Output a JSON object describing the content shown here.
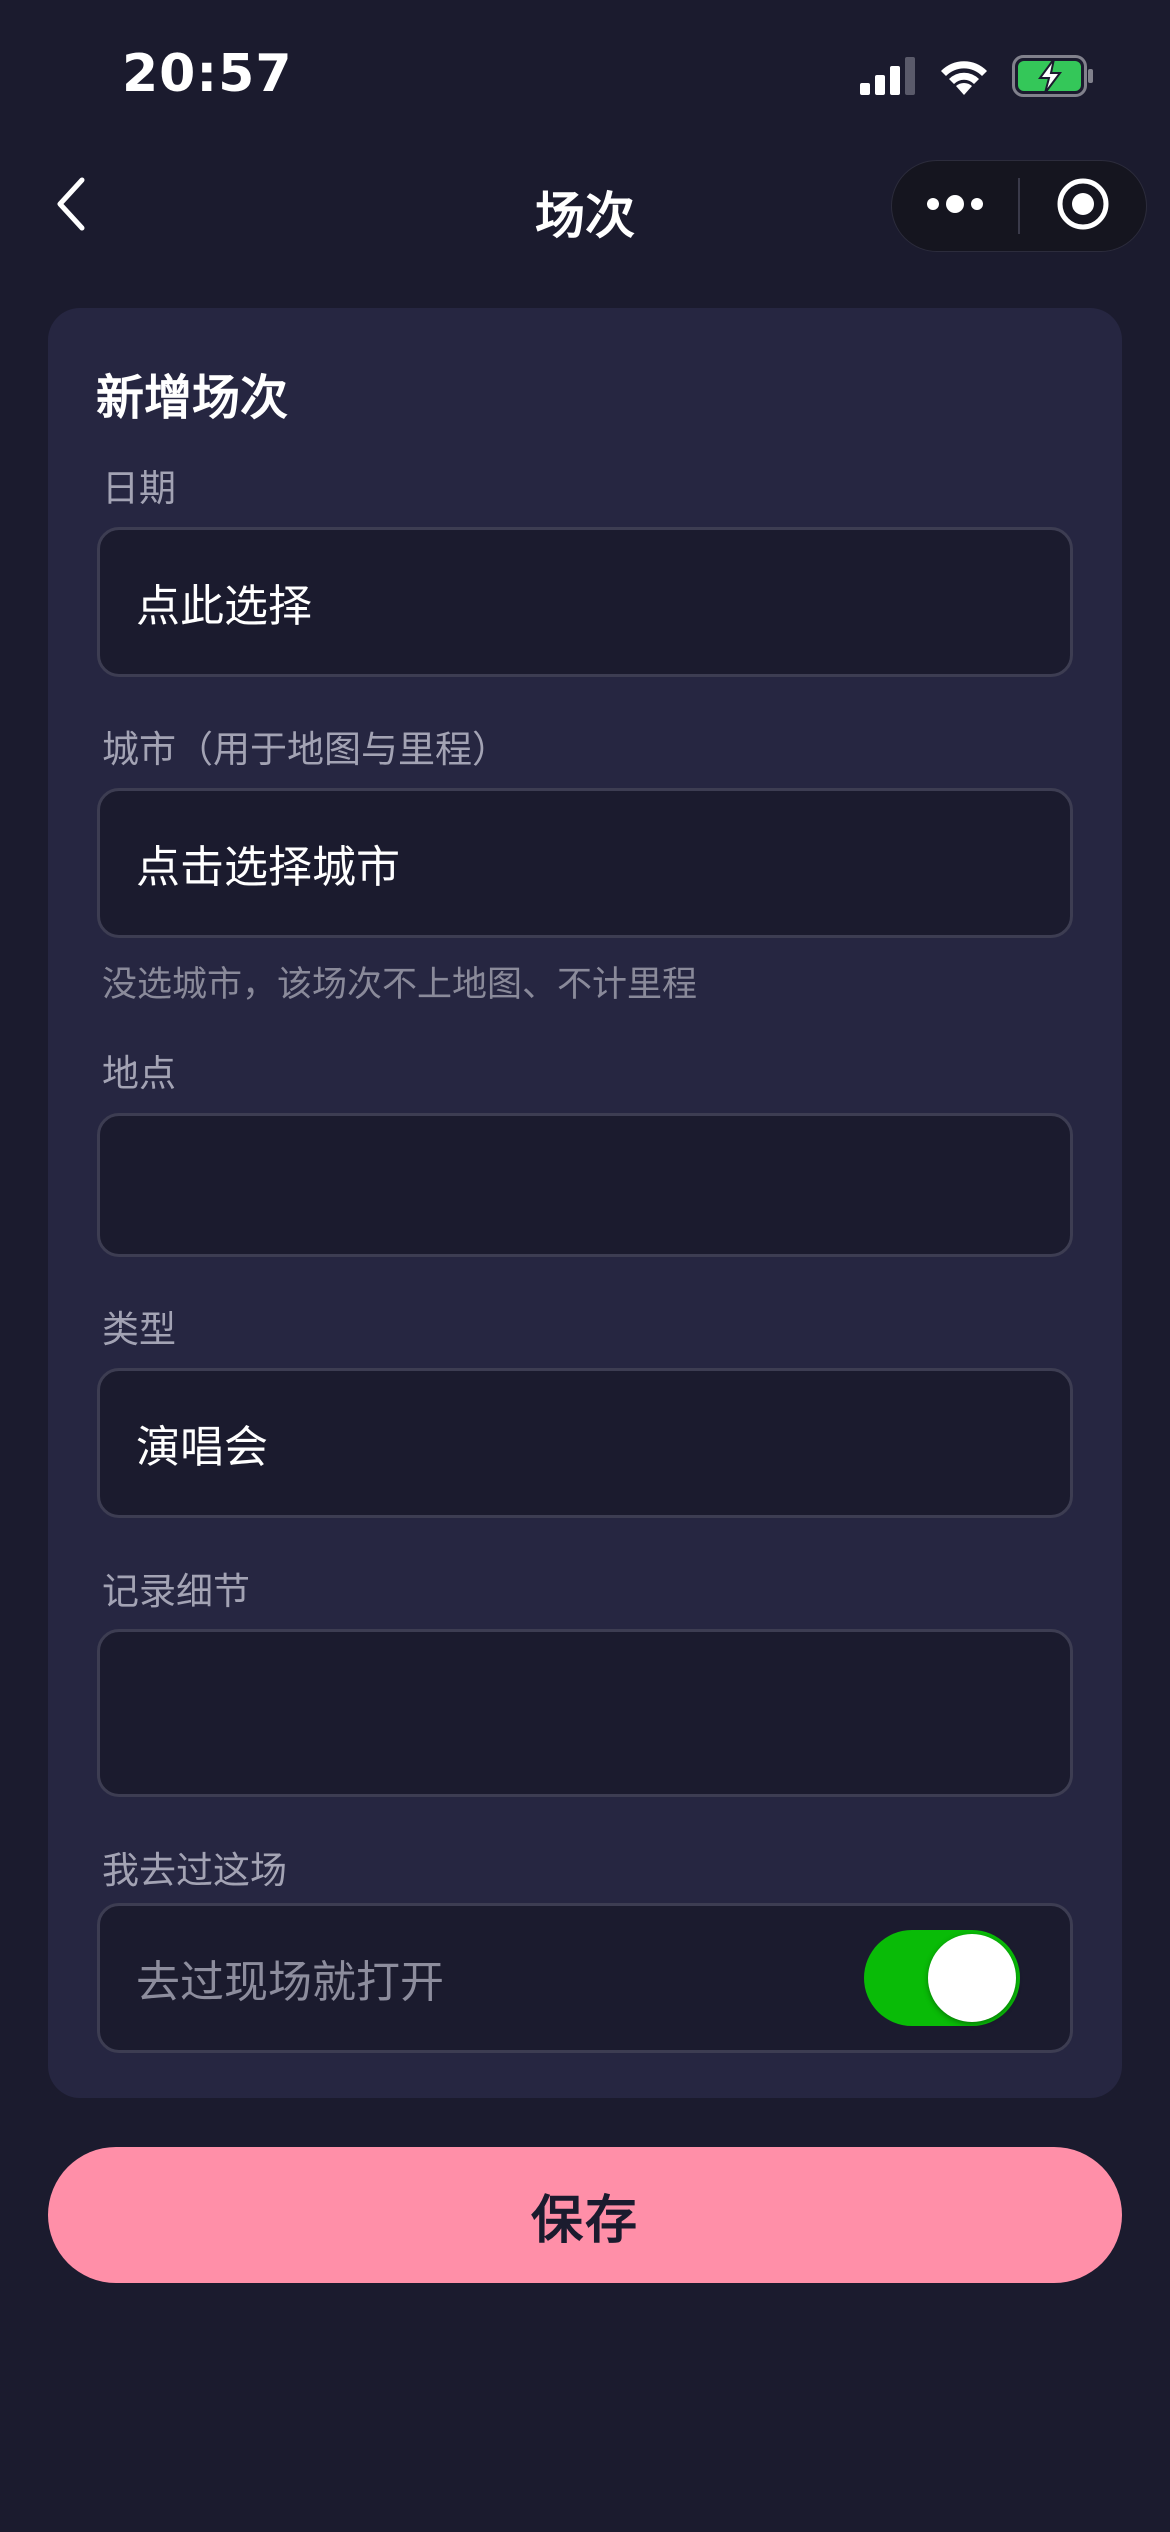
{
  "status_bar": {
    "time": "20:57",
    "icons": [
      "signal-icon",
      "wifi-icon",
      "battery-charging-icon"
    ],
    "battery_color": "#34c759"
  },
  "nav": {
    "title": "场次",
    "back_icon": "chevron-left-icon",
    "more_icon": "more-dots-icon",
    "close_icon": "target-circle-icon"
  },
  "form": {
    "title": "新增场次",
    "date": {
      "label": "日期",
      "value": "点此选择"
    },
    "city": {
      "label": "城市（用于地图与里程）",
      "value": "点击选择城市",
      "hint": "没选城市，该场次不上地图、不计里程"
    },
    "venue": {
      "label": "地点",
      "value": ""
    },
    "type": {
      "label": "类型",
      "value": "演唱会"
    },
    "notes": {
      "label": "记录细节",
      "value": ""
    },
    "attended": {
      "label": "我去过这场",
      "placeholder": "去过现场就打开",
      "on": true,
      "toggle_color": "#09bb07"
    }
  },
  "actions": {
    "save_label": "保存",
    "save_color": "#ff8fa8"
  },
  "colors": {
    "background": "#1b1b2e",
    "card": "#262641",
    "field": "#1b1b2e",
    "border": "#3d3d52"
  }
}
